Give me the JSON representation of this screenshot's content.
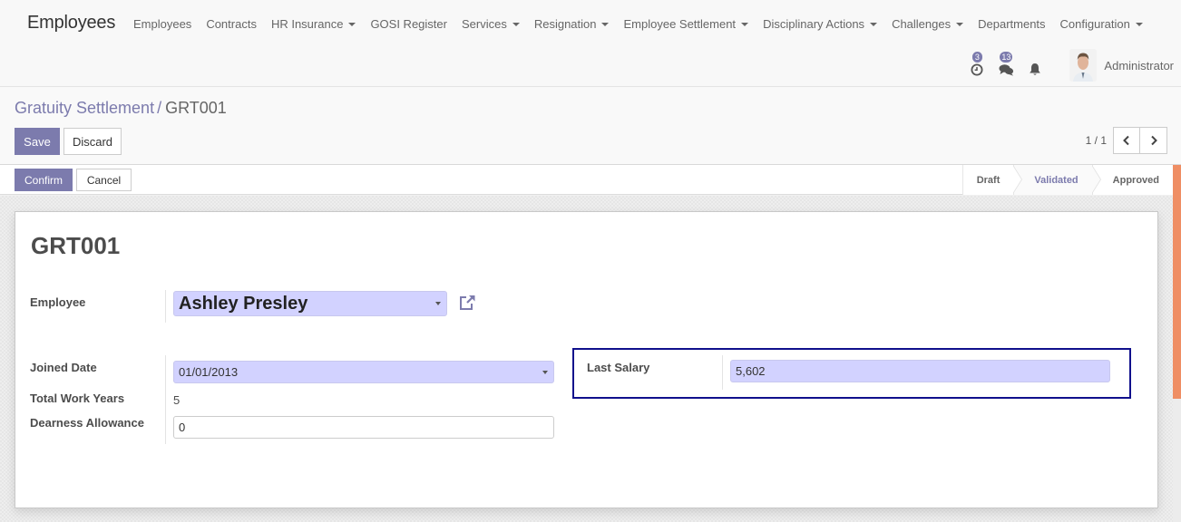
{
  "navbar": {
    "app_title": "Employees",
    "menu": [
      {
        "label": "Employees",
        "dropdown": false
      },
      {
        "label": "Contracts",
        "dropdown": false
      },
      {
        "label": "HR Insurance",
        "dropdown": true
      },
      {
        "label": "GOSI Register",
        "dropdown": false
      },
      {
        "label": "Services",
        "dropdown": true
      },
      {
        "label": "Resignation",
        "dropdown": true
      },
      {
        "label": "Employee Settlement",
        "dropdown": true
      },
      {
        "label": "Disciplinary Actions",
        "dropdown": true
      },
      {
        "label": "Challenges",
        "dropdown": true
      },
      {
        "label": "Departments",
        "dropdown": false
      },
      {
        "label": "Configuration",
        "dropdown": true
      }
    ],
    "systray": {
      "activities_count": "3",
      "messages_count": "13",
      "user_name": "Administrator"
    }
  },
  "control_panel": {
    "breadcrumb": {
      "parent": "Gratuity Settlement",
      "separator": "/",
      "current": "GRT001"
    },
    "save_label": "Save",
    "discard_label": "Discard",
    "pager": "1 / 1"
  },
  "statusbar": {
    "confirm_label": "Confirm",
    "cancel_label": "Cancel",
    "stages": [
      {
        "label": "Draft",
        "active": false
      },
      {
        "label": "Validated",
        "active": true
      },
      {
        "label": "Approved",
        "active": false
      }
    ]
  },
  "form": {
    "title": "GRT001",
    "employee": {
      "label": "Employee",
      "value": "Ashley Presley"
    },
    "joined_date": {
      "label": "Joined Date",
      "value": "01/01/2013"
    },
    "total_work_years": {
      "label": "Total Work Years",
      "value": "5"
    },
    "dearness_allowance": {
      "label": "Dearness Allowance",
      "value": "0"
    },
    "last_salary": {
      "label": "Last Salary",
      "value": "5,602"
    }
  },
  "colors": {
    "brand": "#7c7bad",
    "required_field": "#d2d2ff",
    "scrollbar": "#ef8e64",
    "focus_border": "#10108c"
  }
}
